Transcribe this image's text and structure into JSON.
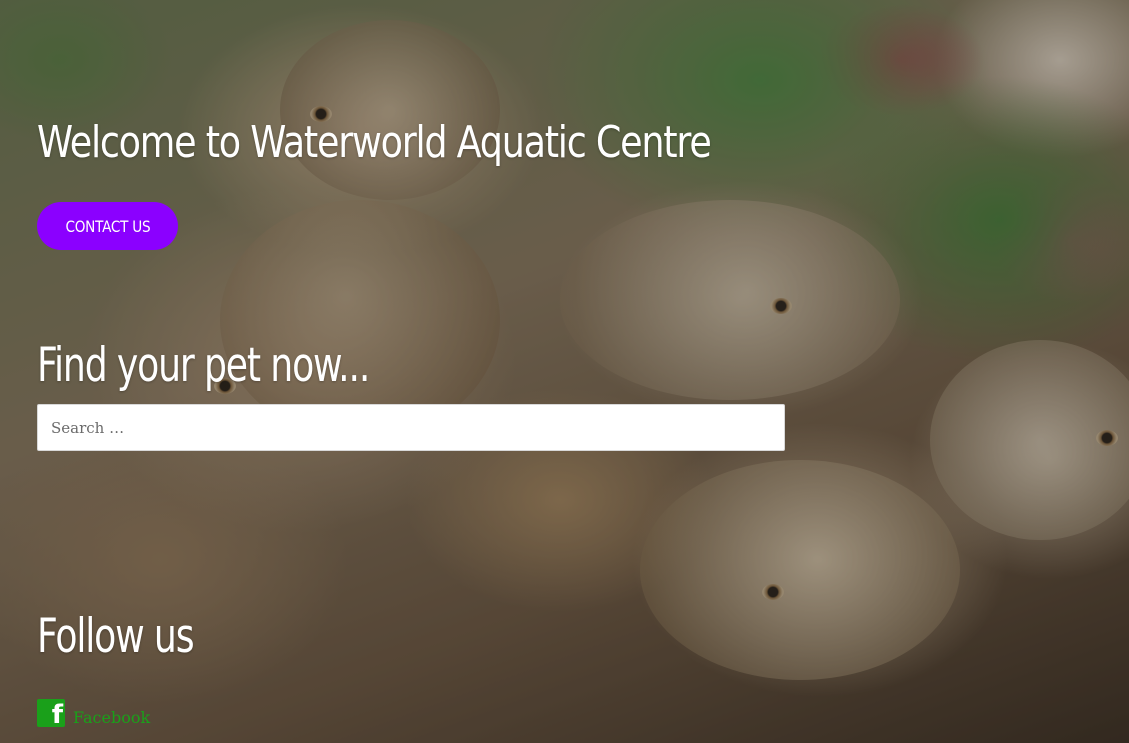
{
  "hero": {
    "heading": "Welcome to Waterworld Aquatic Centre",
    "contact_label": "CONTACT US"
  },
  "search": {
    "heading": "Find your pet now...",
    "placeholder": "Search …"
  },
  "follow": {
    "heading": "Follow us",
    "links": [
      {
        "icon": "facebook-icon",
        "label": "Facebook",
        "color": "#1aa01a"
      }
    ]
  },
  "colors": {
    "button_background": "#8b00ff",
    "heading_text": "#ffffff",
    "link": "#1aa01a"
  }
}
